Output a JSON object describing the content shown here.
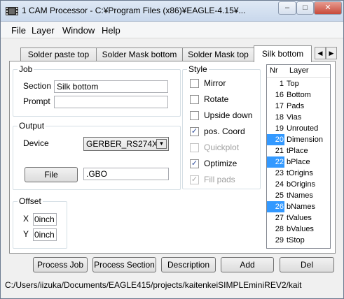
{
  "window": {
    "title": "1 CAM Processor - C:¥Program Files (x86)¥EAGLE-4.15¥...",
    "minimize": "–",
    "maximize": "□",
    "close": "✕"
  },
  "menu": {
    "file": "File",
    "layer": "Layer",
    "window": "Window",
    "help": "Help"
  },
  "tabs": [
    "Solder paste top",
    "Solder Mask bottom",
    "Solder Mask top",
    "Silk bottom"
  ],
  "tab_scroll": {
    "left": "◀",
    "right": "▶"
  },
  "job": {
    "group_label": "Job",
    "section_label": "Section",
    "section_value": "Silk bottom",
    "prompt_label": "Prompt",
    "prompt_value": ""
  },
  "output": {
    "group_label": "Output",
    "device_label": "Device",
    "device_value": "GERBER_RS274X",
    "file_button": "File",
    "file_value": ".GBO"
  },
  "offset": {
    "group_label": "Offset",
    "x_label": "X",
    "x_value": "0inch",
    "y_label": "Y",
    "y_value": "0inch"
  },
  "style": {
    "group_label": "Style",
    "options": [
      {
        "label": "Mirror",
        "checked": false,
        "disabled": false
      },
      {
        "label": "Rotate",
        "checked": false,
        "disabled": false
      },
      {
        "label": "Upside down",
        "checked": false,
        "disabled": false
      },
      {
        "label": "pos. Coord",
        "checked": true,
        "disabled": false
      },
      {
        "label": "Quickplot",
        "checked": false,
        "disabled": true
      },
      {
        "label": "Optimize",
        "checked": true,
        "disabled": false
      },
      {
        "label": "Fill pads",
        "checked": true,
        "disabled": true
      }
    ]
  },
  "layers": {
    "header_nr": "Nr",
    "header_layer": "Layer",
    "rows": [
      {
        "nr": "1",
        "name": "Top",
        "selected": false
      },
      {
        "nr": "16",
        "name": "Bottom",
        "selected": false
      },
      {
        "nr": "17",
        "name": "Pads",
        "selected": false
      },
      {
        "nr": "18",
        "name": "Vias",
        "selected": false
      },
      {
        "nr": "19",
        "name": "Unrouted",
        "selected": false
      },
      {
        "nr": "20",
        "name": "Dimension",
        "selected": true
      },
      {
        "nr": "21",
        "name": "tPlace",
        "selected": false
      },
      {
        "nr": "22",
        "name": "bPlace",
        "selected": true
      },
      {
        "nr": "23",
        "name": "tOrigins",
        "selected": false
      },
      {
        "nr": "24",
        "name": "bOrigins",
        "selected": false
      },
      {
        "nr": "25",
        "name": "tNames",
        "selected": false
      },
      {
        "nr": "26",
        "name": "bNames",
        "selected": true
      },
      {
        "nr": "27",
        "name": "tValues",
        "selected": false
      },
      {
        "nr": "28",
        "name": "bValues",
        "selected": false
      },
      {
        "nr": "29",
        "name": "tStop",
        "selected": false
      }
    ]
  },
  "buttons": {
    "process_job": "Process Job",
    "process_section": "Process Section",
    "description": "Description",
    "add": "Add",
    "del": "Del"
  },
  "status": "C:/Users/iizuka/Documents/EAGLE415/projects/kaitenkeiSIMPLEminiREV2/kait",
  "colors": {
    "selection": "#3399ff",
    "accent": "#2c4a9a"
  }
}
